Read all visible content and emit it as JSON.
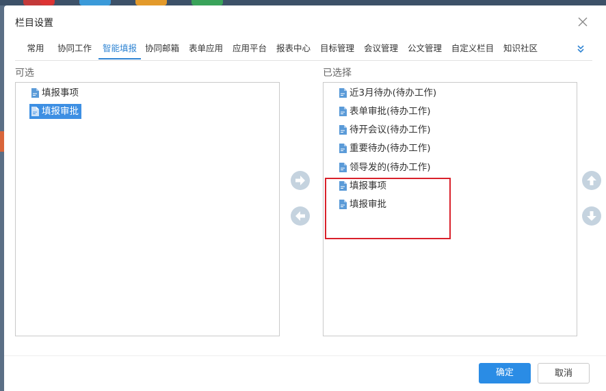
{
  "dialog": {
    "title": "栏目设置",
    "close_icon": "close-icon"
  },
  "tabs": [
    {
      "label": "常用",
      "active": false
    },
    {
      "label": "协同工作",
      "active": false
    },
    {
      "label": "智能填报",
      "active": true
    },
    {
      "label": "协同邮箱",
      "active": false
    },
    {
      "label": "表单应用",
      "active": false
    },
    {
      "label": "应用平台",
      "active": false
    },
    {
      "label": "报表中心",
      "active": false
    },
    {
      "label": "目标管理",
      "active": false
    },
    {
      "label": "会议管理",
      "active": false
    },
    {
      "label": "公文管理",
      "active": false
    },
    {
      "label": "自定义栏目",
      "active": false
    },
    {
      "label": "知识社区",
      "active": false
    }
  ],
  "tabs_more_icon": "double-chevron-down-icon",
  "available": {
    "label": "可选",
    "items": [
      {
        "label": "填报事项",
        "selected": false
      },
      {
        "label": "填报审批",
        "selected": true
      }
    ]
  },
  "chosen": {
    "label": "已选择",
    "items": [
      {
        "label": "近3月待办(待办工作)"
      },
      {
        "label": "表单审批(待办工作)"
      },
      {
        "label": "待开会议(待办工作)"
      },
      {
        "label": "重要待办(待办工作)"
      },
      {
        "label": "领导发的(待办工作)"
      },
      {
        "label": "填报事项"
      },
      {
        "label": "填报审批"
      }
    ]
  },
  "controls": {
    "move_right_icon": "arrow-right-icon",
    "move_left_icon": "arrow-left-icon",
    "move_up_icon": "arrow-up-icon",
    "move_down_icon": "arrow-down-icon"
  },
  "footer": {
    "confirm": "确定",
    "cancel": "取消"
  },
  "colors": {
    "accent": "#2f84d3",
    "primary_button": "#2a8ce5",
    "highlight_border": "#d9202a",
    "round_button": "#c5d3df"
  }
}
